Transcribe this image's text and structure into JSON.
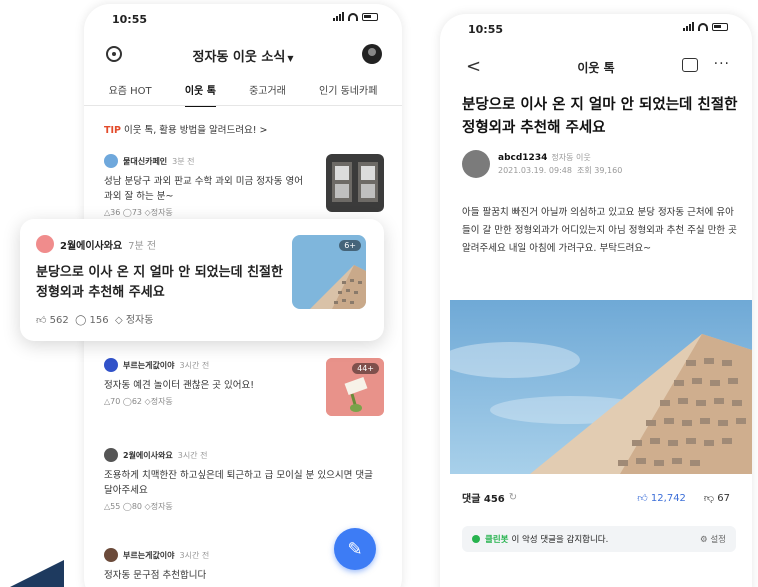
{
  "left_screen": {
    "status_time": "10:55",
    "location_title": "정자동 이웃 소식",
    "tabs": [
      "요즘 HOT",
      "이웃 톡",
      "중고거래",
      "인기 동네카페"
    ],
    "active_tab": "이웃 톡",
    "tip_tag": "TIP",
    "tip_text": "이웃 톡, 활용 방법을 알려드려요! >",
    "posts": [
      {
        "author": "물대신카페인",
        "time": "3분 전",
        "body": "성남 분당구 과외 판교 수학 과외 미금 정자동 영어 과외 잘 하는 분~",
        "stats": "△36 ◯73 ◇정자동"
      },
      {
        "author": "부르는게값이야",
        "time": "3시간 전",
        "body": "정자동 예견 놀이터 괜찮은 곳 있어요!",
        "stats": "△70 ◯62 ◇정자동",
        "thumb_count": "44+"
      },
      {
        "author": "2월에이사와요",
        "time": "3시간 전",
        "body": "조용하게 치맥한잔 하고싶은데 퇴근하고 급 모이실 분 있으시면 댓글 달아주세요",
        "stats": "△55 ◯80 ◇정자동"
      },
      {
        "author": "부르는게값이야",
        "time": "3시간 전",
        "body": "정자동 문구점 추천합니다"
      }
    ],
    "highlight_card": {
      "author": "2월에이사와요",
      "time": "7분 전",
      "headline": "분당으로 이사 온 지 얼마 안 되었는데 친절한 정형외과 추천해 주세요",
      "likes": "562",
      "comments": "156",
      "location": "정자동",
      "image_count": "6+"
    }
  },
  "right_screen": {
    "status_time": "10:55",
    "title": "이웃 톡",
    "headline": "분당으로 이사 온 지 얼마 안 되었는데 친절한 정형외과 추천해 주세요",
    "author_id": "abcd1234",
    "author_location": "정자동 이웃",
    "post_date": "2021.03.19. 09:48",
    "views": "조회 39,160",
    "body": "아들 팔꿈치 빠진거 아닐까 의심하고 있고요 분당 정자동 근처에 유아들이 갈 만한 정형외과가 어디있는지 아님 정형외과 추천 주실 만한 곳 알려주세요 내일 아침에 가려구요. 부탁드려요~",
    "comments_label": "댓글 456",
    "likes": "12,742",
    "dislikes": "67",
    "filter_brand": "클린봇",
    "filter_text": "이 악성 댓글을 감지합니다.",
    "filter_setting": "⚙ 설정"
  },
  "colors": {
    "accent_blue": "#3d7cf5",
    "tip_red": "#e34b2b",
    "clean_green": "#27b34e",
    "sky": "#7fb6dc"
  }
}
